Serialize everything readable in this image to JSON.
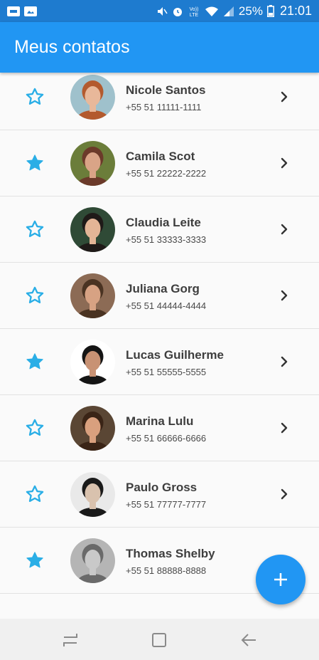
{
  "status_bar": {
    "battery_percent": "25%",
    "time": "21:01",
    "network_label": "LTE",
    "left_icons": [
      "notification-icon",
      "image-icon"
    ],
    "right_icons": [
      "mute-icon",
      "alarm-icon",
      "volte-icon",
      "wifi-icon",
      "signal-icon",
      "battery-icon"
    ]
  },
  "app_bar": {
    "title": "Meus contatos"
  },
  "colors": {
    "primary": "#2196f3",
    "status_bar": "#1e7bcf",
    "star": "#2aaee6",
    "name_text": "#3e3e3e",
    "phone_text": "#4a4a4a"
  },
  "contacts": [
    {
      "name": "Nicole Santos",
      "phone": "+55 51 11111-1111",
      "favorite": false
    },
    {
      "name": "Camila Scot",
      "phone": "+55 51 22222-2222",
      "favorite": true
    },
    {
      "name": "Claudia Leite",
      "phone": "+55 51 33333-3333",
      "favorite": false
    },
    {
      "name": "Juliana Gorg",
      "phone": "+55 51 44444-4444",
      "favorite": false
    },
    {
      "name": "Lucas Guilherme",
      "phone": "+55 51 55555-5555",
      "favorite": true
    },
    {
      "name": "Marina Lulu",
      "phone": "+55 51 66666-6666",
      "favorite": false
    },
    {
      "name": "Paulo Gross",
      "phone": "+55 51 77777-7777",
      "favorite": false
    },
    {
      "name": "Thomas Shelby",
      "phone": "+55 51 88888-8888",
      "favorite": true
    }
  ],
  "fab": {
    "icon": "plus-icon"
  },
  "nav_bar": {
    "buttons": [
      "recent-apps-icon",
      "home-icon",
      "back-icon"
    ]
  }
}
